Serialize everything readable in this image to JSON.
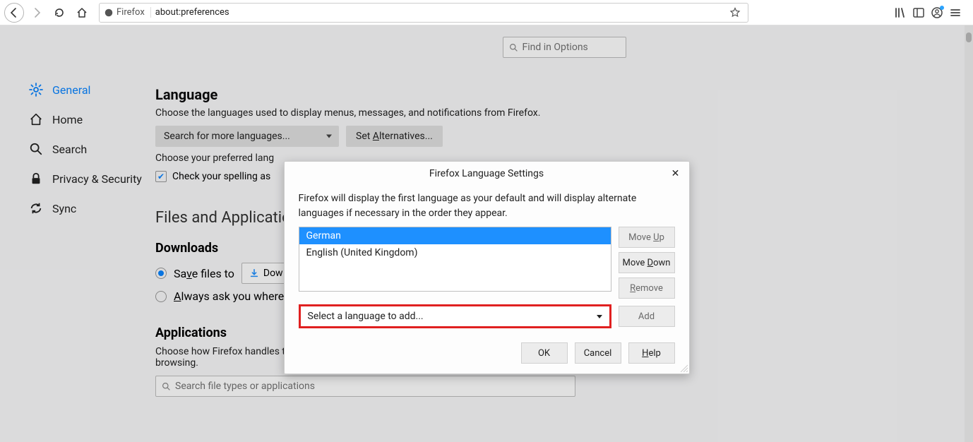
{
  "toolbar": {
    "identity_label": "Firefox",
    "url": "about:preferences"
  },
  "search_options": {
    "placeholder": "Find in Options"
  },
  "sidebar": {
    "items": [
      {
        "label": "General"
      },
      {
        "label": "Home"
      },
      {
        "label": "Search"
      },
      {
        "label": "Privacy & Security"
      },
      {
        "label": "Sync"
      }
    ]
  },
  "language": {
    "title": "Language",
    "desc": "Choose the languages used to display menus, messages, and notifications from Firefox.",
    "search_more": "Search for more languages...",
    "set_alt": "Set Alternatives...",
    "pref_prefix": "Choose your preferred lang",
    "spelling": "Check your spelling as "
  },
  "files": {
    "title": "Files and Application",
    "downloads_title": "Downloads",
    "save_to": "Save files to",
    "download_btn_prefix": "Dow",
    "always_ask": "Always ask you where "
  },
  "apps": {
    "title": "Applications",
    "desc": "Choose how Firefox handles the files you download from the web or the applications you use while browsing.",
    "search_placeholder": "Search file types or applications"
  },
  "dialog": {
    "title": "Firefox Language Settings",
    "desc": "Firefox will display the first language as your default and will display alternate languages if necessary in the order they appear.",
    "languages": [
      "German",
      "English (United Kingdom)"
    ],
    "move_up": "Move Up",
    "move_down": "Move Down",
    "remove": "Remove",
    "add": "Add",
    "select_placeholder": "Select a language to add...",
    "ok": "OK",
    "cancel": "Cancel",
    "help": "Help"
  }
}
